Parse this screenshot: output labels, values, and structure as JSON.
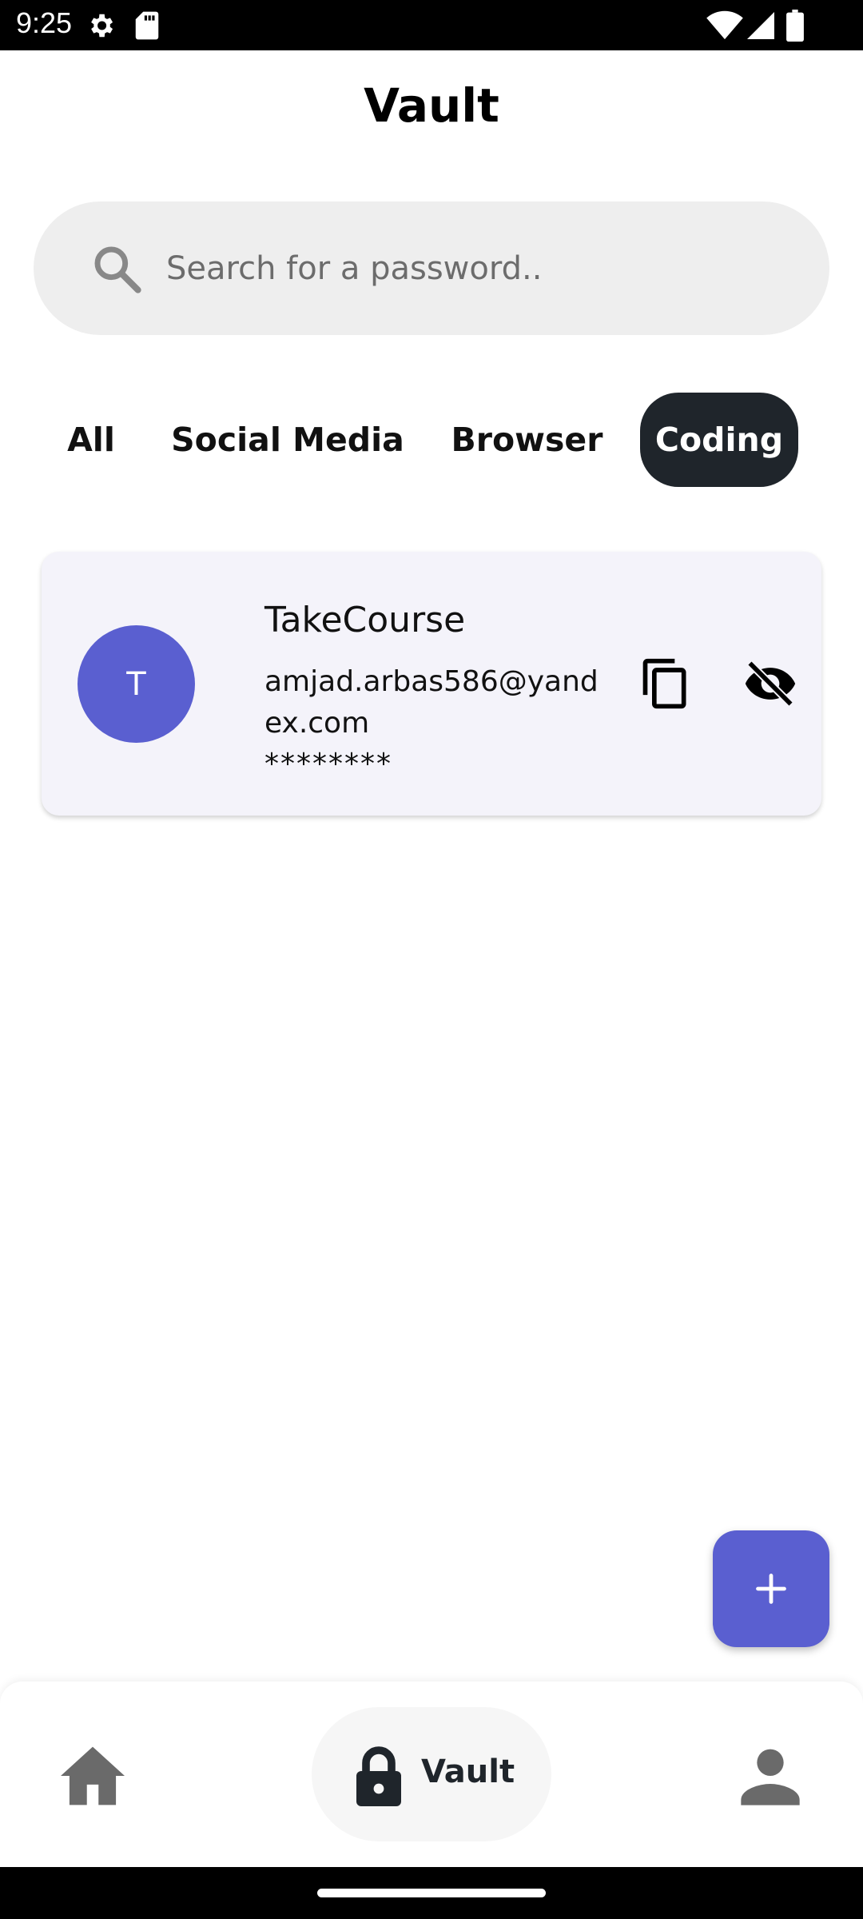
{
  "status_bar": {
    "time": "9:25",
    "icons": [
      "gear-icon",
      "sd-card-icon",
      "wifi-icon",
      "signal-icon",
      "battery-icon"
    ]
  },
  "header": {
    "title": "Vault"
  },
  "search": {
    "placeholder": "Search for a password..",
    "value": ""
  },
  "tabs": [
    {
      "label": "All",
      "selected": false
    },
    {
      "label": "Social Media",
      "selected": false
    },
    {
      "label": "Browser",
      "selected": false
    },
    {
      "label": "Coding",
      "selected": true
    }
  ],
  "entries": [
    {
      "avatar_letter": "T",
      "title": "TakeCourse",
      "email": "amjad.arbas586@yandex.com",
      "password": "********"
    }
  ],
  "bottom_nav": {
    "items": [
      {
        "icon": "home-icon",
        "label": ""
      },
      {
        "icon": "lock-icon",
        "label": "Vault",
        "selected": true
      },
      {
        "icon": "person-icon",
        "label": ""
      }
    ]
  },
  "colors": {
    "accent": "#5a5fd0",
    "selected_tab": "#1f252b",
    "search_bg": "#eeeeee",
    "card_bg": "#f4f3fa"
  }
}
